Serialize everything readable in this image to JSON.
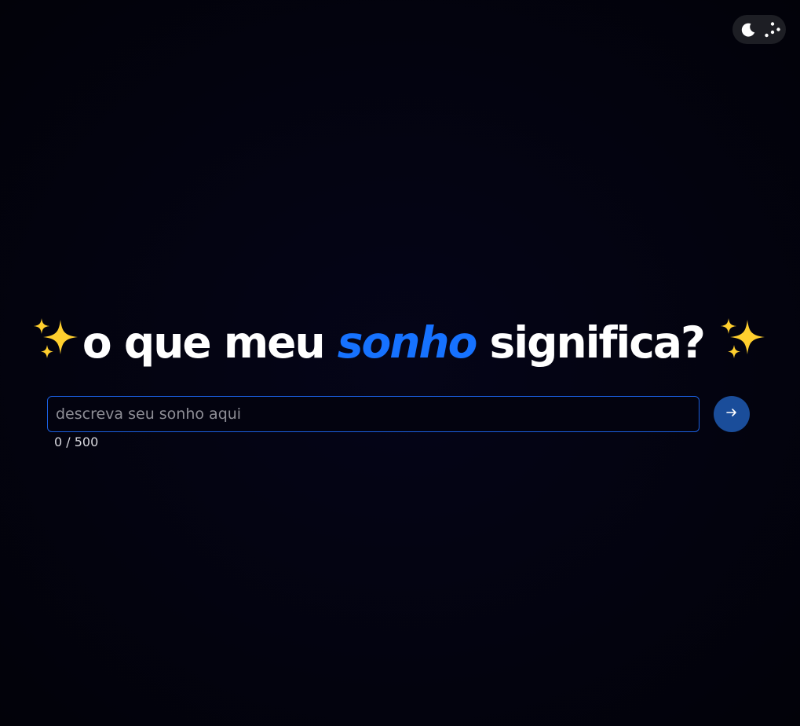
{
  "theme_toggle": {
    "left_icon": "moon-icon",
    "right_icon": "stars-icon"
  },
  "headline": {
    "sparkle_icon": "sparkles-icon",
    "prefix": "o que meu ",
    "accent": "sonho",
    "suffix": " significa?",
    "accent_color": "#1672ff"
  },
  "dream_input": {
    "placeholder": "descreva seu sonho aqui",
    "value": ""
  },
  "char_counter": {
    "text": "0 / 500"
  },
  "submit": {
    "icon": "arrow-right-icon",
    "color": "#1a4d9a"
  }
}
